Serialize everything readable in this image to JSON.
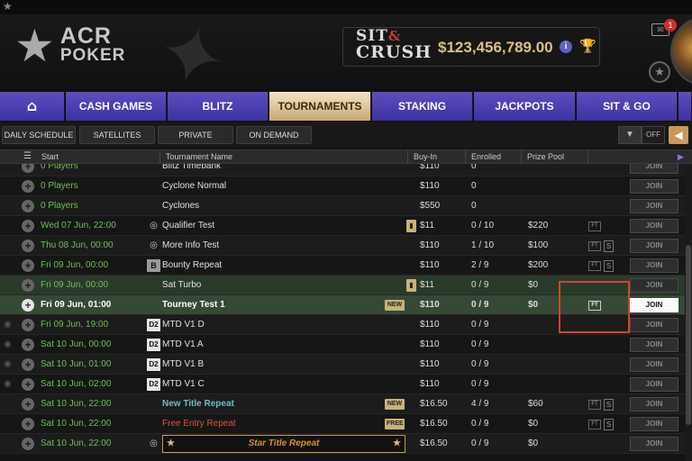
{
  "header": {
    "logo_acr": "ACR",
    "logo_poker": "POKER",
    "sitcrush": {
      "sit": "SIT",
      "amp": "&",
      "crush": "CRUSH",
      "amount": "$123,456,789.00"
    },
    "mail_count": "1"
  },
  "nav": {
    "tabs": [
      {
        "label": "CASH GAMES"
      },
      {
        "label": "BLITZ"
      },
      {
        "label": "TOURNAMENTS"
      },
      {
        "label": "STAKING"
      },
      {
        "label": "JACKPOTS"
      },
      {
        "label": "SIT & GO"
      }
    ],
    "active": "TOURNAMENTS"
  },
  "subnav": {
    "buttons": [
      "DAILY SCHEDULE",
      "SATELLITES",
      "PRIVATE",
      "ON DEMAND"
    ],
    "off_label": "OFF"
  },
  "table": {
    "headers": {
      "start": "Start",
      "name": "Tournament Name",
      "buyin": "Buy-In",
      "enrolled": "Enrolled",
      "prize": "Prize Pool"
    },
    "join_label": "JOIN",
    "rows": [
      {
        "start": "0 Players",
        "name": "Blitz Timebank",
        "buyin": "$110",
        "enrolled": "0",
        "prize": ""
      },
      {
        "start": "0 Players",
        "name": "Cyclone Normal",
        "buyin": "$110",
        "enrolled": "0",
        "prize": ""
      },
      {
        "start": "0 Players",
        "name": "Cyclones",
        "buyin": "$550",
        "enrolled": "0",
        "prize": ""
      },
      {
        "start": "Wed 07 Jun, 22:00",
        "name": "Qualifier Test",
        "buyin": "$11",
        "enrolled": "0 / 10",
        "prize": "$220"
      },
      {
        "start": "Thu 08 Jun, 00:00",
        "name": "More Info Test",
        "buyin": "$110",
        "enrolled": "1 / 10",
        "prize": "$100"
      },
      {
        "start": "Fri   09 Jun, 00:00",
        "name": "Bounty Repeat",
        "buyin": "$110",
        "enrolled": "2 / 9",
        "prize": "$200"
      },
      {
        "start": "Fri   09 Jun, 00:00",
        "name": "Sat Turbo",
        "buyin": "$11",
        "enrolled": "0 / 9",
        "prize": "$0"
      },
      {
        "start": "Fri   09 Jun, 01:00",
        "name": "Tourney Test 1",
        "buyin": "$110",
        "enrolled": "0 / 9",
        "prize": "$0",
        "tag": "NEW"
      },
      {
        "start": "Fri   09 Jun, 19:00",
        "name": "MTD V1 D",
        "buyin": "$110",
        "enrolled": "0 / 9",
        "prize": ""
      },
      {
        "start": "Sat   10 Jun, 00:00",
        "name": "MTD V1 A",
        "buyin": "$110",
        "enrolled": "0 / 9",
        "prize": ""
      },
      {
        "start": "Sat   10 Jun, 01:00",
        "name": "MTD V1 B",
        "buyin": "$110",
        "enrolled": "0 / 9",
        "prize": ""
      },
      {
        "start": "Sat   10 Jun, 02:00",
        "name": "MTD V1 C",
        "buyin": "$110",
        "enrolled": "0 / 9",
        "prize": ""
      },
      {
        "start": "Sat   10 Jun, 22:00",
        "name": "New Title Repeat",
        "buyin": "$16.50",
        "enrolled": "4 / 9",
        "prize": "$60",
        "tag": "NEW"
      },
      {
        "start": "Sat   10 Jun, 22:00",
        "name": "Free Entry Repeat",
        "buyin": "$16.50",
        "enrolled": "0 / 9",
        "prize": "$0",
        "tag": "FREE"
      },
      {
        "start": "Sat   10 Jun, 22:00",
        "name": "Star Title Repeat",
        "buyin": "$16.50",
        "enrolled": "0 / 9",
        "prize": "$0"
      }
    ]
  },
  "icons": {
    "ft": "FT",
    "s": "S",
    "d2": "D2",
    "bounty": "B"
  },
  "colors": {
    "nav_tab": "#4a3fb5",
    "nav_active": "#e8d4b0",
    "green_text": "#6fbf5a",
    "teal_text": "#66c0c8",
    "red_text": "#e0523f",
    "highlight_box": "#d8422f"
  }
}
